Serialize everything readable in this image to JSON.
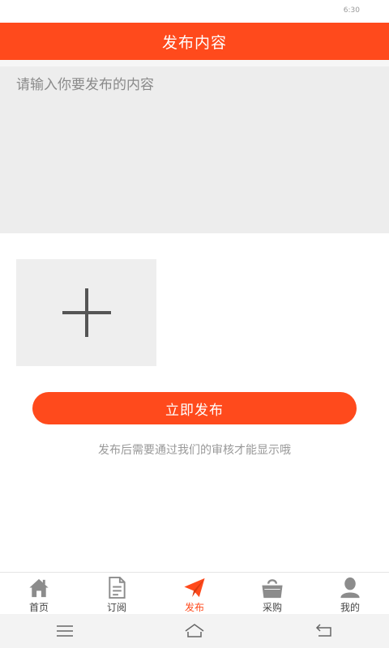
{
  "status_bar": {
    "clock": "6:30"
  },
  "header": {
    "title": "发布内容"
  },
  "content": {
    "placeholder": "请输入你要发布的内容",
    "value": ""
  },
  "publish": {
    "label": "立即发布",
    "hint": "发布后需要通过我们的审核才能显示哦"
  },
  "tabs": [
    {
      "label": "首页",
      "icon": "home-icon"
    },
    {
      "label": "订阅",
      "icon": "document-icon"
    },
    {
      "label": "发布",
      "icon": "paper-plane-icon",
      "active": true
    },
    {
      "label": "采购",
      "icon": "shopping-bag-icon"
    },
    {
      "label": "我的",
      "icon": "user-icon"
    }
  ],
  "colors": {
    "accent": "#ff4a1c",
    "input_bg": "#ededed",
    "hint": "#999999"
  }
}
